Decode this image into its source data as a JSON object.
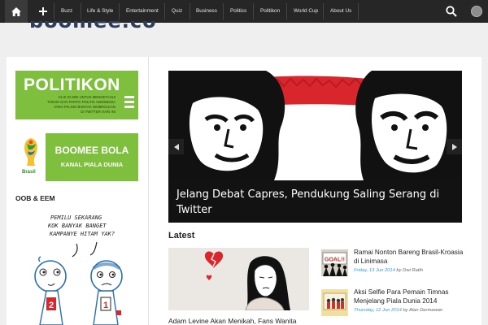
{
  "nav": {
    "items": [
      "Buzz",
      "Life & Style",
      "Entertainment",
      "Quiz",
      "Business",
      "Politics",
      "Politikon",
      "World Cup",
      "About Us"
    ]
  },
  "logo": {
    "text": "boomee.co"
  },
  "sidebar": {
    "politikon": {
      "title": "POLITIKON",
      "lines": [
        "KLIK DI SINI UNTUK MENGETAHUI",
        "TOKOH DAN PARTAI POLITIK INDONESIA",
        "YANG PALING BANYAK DIOBROLKAN",
        "DI TWITTER HARI INI"
      ]
    },
    "bola": {
      "title": "BOOMEE BOLA",
      "subtitle": "KANAL PIALA DUNIA",
      "badge": "Brasil"
    },
    "section_heading": "OOB & EEM",
    "comic_lines": [
      "PEMILU SEKARANG",
      "KOK BANYAK BANGET",
      "KAMPANYE HITAM YAK?"
    ],
    "comic_numbers": [
      "2",
      "1"
    ]
  },
  "slider": {
    "caption": "Jelang Debat Capres, Pendukung Saling Serang di Twitter"
  },
  "latest": {
    "heading": "Latest",
    "feature_title": "Adam Levine Akan Menikah, Fans Wanita",
    "items": [
      {
        "title": "Ramai Nonton Bareng Brasil-Kroasia di Linimasa",
        "date": "Friday, 13 Jun 2014",
        "by": " by ",
        "author": "Dwi Ratih",
        "thumb_text": "GOAL!!"
      },
      {
        "title": "Aksi Selfie Para Pemain Timnas Menjelang Piala Dunia 2014",
        "date": "Thursday, 12 Jun 2014",
        "by": " by ",
        "author": "Alan Dermawan"
      }
    ]
  },
  "colors": {
    "nav_bg": "#262626",
    "brand_green": "#7fbf3e",
    "date_blue": "#3b9ad9",
    "flag_red": "#d8262c"
  },
  "icons": [
    "home-icon",
    "plus-icon",
    "search-icon",
    "arrow-left-icon",
    "arrow-right-icon"
  ]
}
